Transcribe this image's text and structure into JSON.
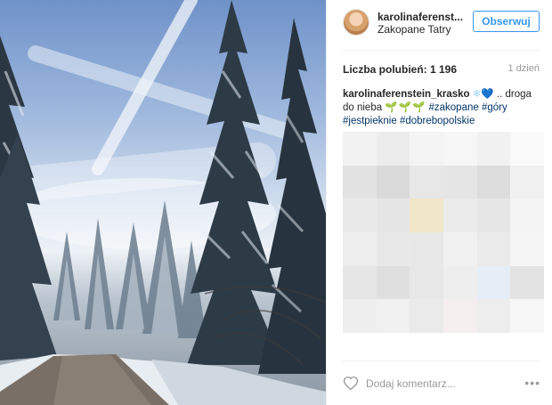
{
  "post": {
    "photo_alt": "",
    "header": {
      "username": "karolinaferenst...",
      "location": "Zakopane Tatry",
      "follow_label": "Obserwuj"
    },
    "stats": {
      "likes": "Liczba polubień: 1 196",
      "time_ago": "1 dzień"
    },
    "caption": {
      "username": "karolinaferenstein_krasko",
      "emoji_snow": "❄",
      "emoji_heart": "💙",
      "text": " .. droga do nieba ",
      "emoji_leaves": "🌱🌱🌱",
      "hashtags": [
        "#zakopane",
        "#góry",
        "#jestpieknie",
        "#dobrebopolskie"
      ]
    },
    "comment_box": {
      "placeholder": "Dodaj komentarz..."
    },
    "more_label": "•••"
  },
  "colors": {
    "accent": "#3897f0",
    "hashtag": "#003569",
    "muted": "#999999",
    "divider": "#efefef"
  },
  "icons": {
    "like": "heart-outline-icon",
    "more": "ellipsis-icon"
  },
  "blurred_comments": {
    "grid_colors": [
      [
        "#f2f2f2",
        "#ececec",
        "#f4f4f4",
        "#f6f6f6",
        "#f1f1f1",
        "#fafafa"
      ],
      [
        "#e2e2e2",
        "#dadada",
        "#e7e7e7",
        "#e5e5e5",
        "#dddddd",
        "#f0f0f0"
      ],
      [
        "#e9e9e9",
        "#e5e5e5",
        "#f1e6c8",
        "#ebebeb",
        "#e6e6e6",
        "#f3f3f3"
      ],
      [
        "#eeeeee",
        "#e8e8e8",
        "#e7e7e7",
        "#f0f0f0",
        "#eaeaea",
        "#f5f5f5"
      ],
      [
        "#e6e6e6",
        "#dfdfdf",
        "#e7e7e7",
        "#eeeeee",
        "#e5eef7",
        "#e3e3e3"
      ],
      [
        "#eeeeee",
        "#f0f0f0",
        "#eaeaea",
        "#f5eeee",
        "#ededed",
        "#f7f7f7"
      ]
    ]
  }
}
